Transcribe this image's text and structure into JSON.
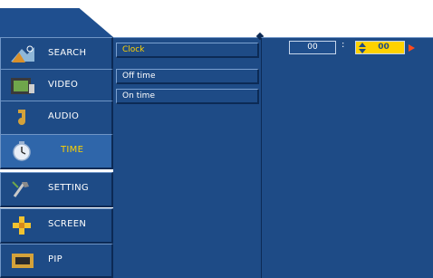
{
  "nav": {
    "items": [
      {
        "label": "SEARCH",
        "icon": "search-icon"
      },
      {
        "label": "VIDEO",
        "icon": "video-icon"
      },
      {
        "label": "AUDIO",
        "icon": "audio-icon"
      },
      {
        "label": "TIME",
        "icon": "time-icon"
      },
      {
        "label": "SETTING",
        "icon": "setting-icon"
      },
      {
        "label": "SCREEN",
        "icon": "screen-icon"
      },
      {
        "label": "PIP",
        "icon": "pip-icon"
      }
    ],
    "active_index": 3
  },
  "menu": {
    "items": [
      {
        "label": "Clock"
      },
      {
        "label": "Off time"
      },
      {
        "label": "On time"
      }
    ],
    "active_index": 0
  },
  "clock": {
    "hour": "00",
    "separator": ":",
    "minute": "00"
  },
  "colors": {
    "panel": "#1e4b86",
    "highlight_text": "#ffd200",
    "arrow": "#ff4a1a"
  }
}
